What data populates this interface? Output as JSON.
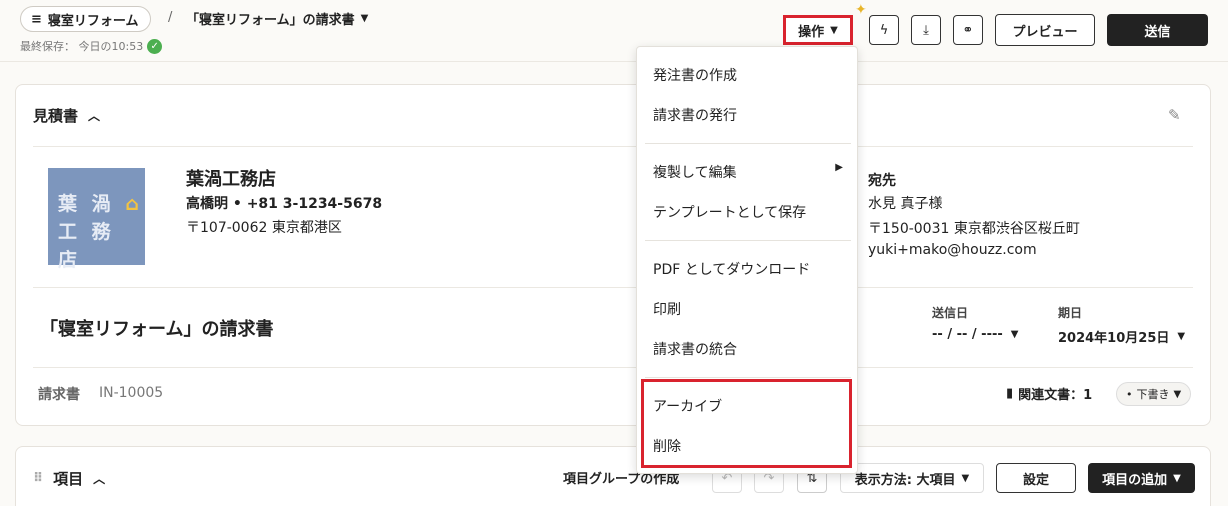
{
  "header": {
    "project_label": "寝室リフォーム",
    "separator": "/",
    "doc_name": "「寝室リフォーム」の請求書",
    "saved_text": "最終保存： 今日の10:53",
    "ops_label": "操作",
    "preview_label": "プレビュー",
    "send_label": "送信"
  },
  "estimate": {
    "title": "見積書",
    "logo_line1": "葉 渦",
    "logo_line2": "工 務 店",
    "company": "葉渦工務店",
    "contact": "高橋明 • +81 3-1234-5678",
    "address": "〒107-0062 東京都港区",
    "dest_title": "宛先",
    "dest_name": "水見 真子様",
    "dest_address": "〒150-0031 東京都渋谷区桜丘町",
    "dest_email": "yuki+mako@houzz.com",
    "doc_title": "「寝室リフォーム」の請求書",
    "send_date_label": "送信日",
    "send_date_value": "-- / -- / ----",
    "due_label": "期日",
    "due_value": "2024年10月25日",
    "invoice_label": "請求書",
    "invoice_number": "IN-10005",
    "related_label": "関連文書：1",
    "status": "下書き"
  },
  "items_section": {
    "title": "項目",
    "group_create": "項目グループの作成",
    "view_label": "表示方法: 大項目",
    "settings_label": "設定",
    "add_label": "項目の追加"
  },
  "menu": {
    "items": [
      "発注書の作成",
      "請求書の発行",
      "複製して編集",
      "テンプレートとして保存",
      "PDF としてダウンロード",
      "印刷",
      "請求書の統合",
      "アーカイブ",
      "削除"
    ]
  },
  "colors": {
    "highlight": "#d9232e",
    "dark_button": "#222222",
    "logo_bg": "#7d96bd"
  }
}
